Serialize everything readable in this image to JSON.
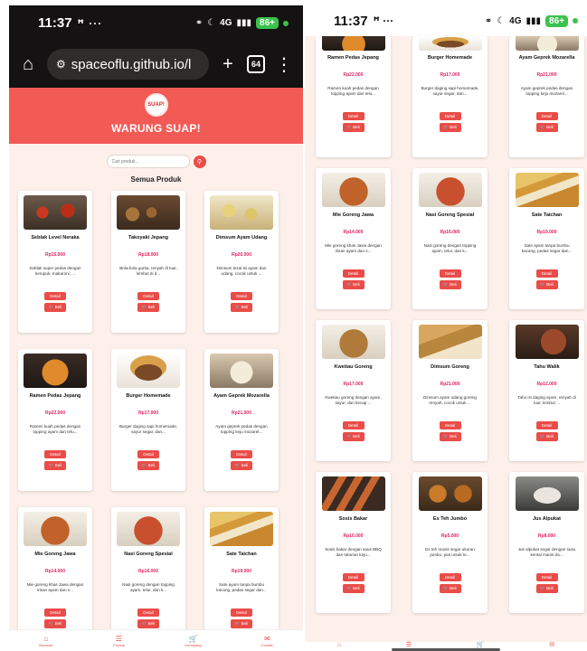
{
  "status": {
    "time": "11:37",
    "time_extra": "ꟸ ···",
    "battery": "86+",
    "signal": "4G"
  },
  "browser": {
    "url": "spaceoflu.github.io/l",
    "tabs": "64"
  },
  "header": {
    "logo_text": "SUAP!",
    "brand": "WARUNG SUAP!"
  },
  "search": {
    "placeholder": "Cari produk..."
  },
  "section_title": "Semua Produk",
  "buttons": {
    "detail": "Detail",
    "buy": "🛒 Beli"
  },
  "nav": [
    {
      "label": "Beranda",
      "icon": "home-icon"
    },
    {
      "label": "Produk",
      "icon": "list-icon"
    },
    {
      "label": "Keranjang",
      "icon": "cart-icon"
    },
    {
      "label": "Kontak",
      "icon": "mail-icon"
    }
  ],
  "products_left": [
    {
      "name": "Seblak Level Neraka",
      "price": "Rp15.000",
      "desc": "Seblak super pedas dengan kerupuk, makaroni, ..."
    },
    {
      "name": "Takoyaki Jepang",
      "price": "Rp18.000",
      "desc": "Bola-bola gurita, renyah di luar, lembut di d..."
    },
    {
      "name": "Dimsum Ayam Udang",
      "price": "Rp20.000",
      "desc": "Dimsum lezat isi ayam dan udang, cocok untuk ..."
    },
    {
      "name": "Ramen Pedas Jepang",
      "price": "Rp22.000",
      "desc": "Ramen kuah pedas dengan topping ayam dan telu..."
    },
    {
      "name": "Burger Homemade",
      "price": "Rp17.000",
      "desc": "Burger daging sapi homemade, sayur segar, dan..."
    },
    {
      "name": "Ayam Geprek Mozarella",
      "price": "Rp21.000",
      "desc": "Ayam geprek pedas dengan topping keju mozarel..."
    },
    {
      "name": "Mie Goreng Jawa",
      "price": "Rp14.000",
      "desc": "Mie goreng khas Jawa dengan irisan ayam dan s..."
    },
    {
      "name": "Nasi Goreng Spesial",
      "price": "Rp16.000",
      "desc": "Nasi goreng dengan topping ayam, telur, dan k..."
    },
    {
      "name": "Sate Taichan",
      "price": "Rp19.000",
      "desc": "Sate ayam tanpa bumbu kacang, pedas segar dan..."
    }
  ],
  "products_right": [
    {
      "name": "Ramen Pedas Jepang",
      "price": "Rp22.000",
      "desc": "Ramen kuah pedas dengan topping ayam dan telu..."
    },
    {
      "name": "Burger Homemade",
      "price": "Rp17.000",
      "desc": "Burger daging sapi homemade, sayur segar, dan..."
    },
    {
      "name": "Ayam Geprek Mozarella",
      "price": "Rp21.000",
      "desc": "Ayam geprek pedas dengan topping keju mozarel..."
    },
    {
      "name": "Mie Goreng Jawa",
      "price": "Rp14.000",
      "desc": "Mie goreng khas Jawa dengan irisan ayam dan s..."
    },
    {
      "name": "Nasi Goreng Spesial",
      "price": "Rp16.000",
      "desc": "Nasi goreng dengan topping ayam, telur, dan k..."
    },
    {
      "name": "Sate Taichan",
      "price": "Rp19.000",
      "desc": "Sate ayam tanpa bumbu kacang, pedas segar dan..."
    },
    {
      "name": "Kwetiau Goreng",
      "price": "Rp17.000",
      "desc": "Kwetiau goreng dengan ayam, sayur, dan kecap ..."
    },
    {
      "name": "Dimsum Goreng",
      "price": "Rp21.000",
      "desc": "Dimsum ayam udang goreng renyah, cocok untuk ..."
    },
    {
      "name": "Tahu Walik",
      "price": "Rp12.000",
      "desc": "Tahu isi daging ayam, renyah di luar, lembut ..."
    },
    {
      "name": "Sosis Bakar",
      "price": "Rp10.000",
      "desc": "Sosis bakar dengan saus BBQ dan taburan keju..."
    },
    {
      "name": "Es Teh Jumbo",
      "price": "Rp5.000",
      "desc": "Es teh manis segar ukuran jumbo, pas untuk te..."
    },
    {
      "name": "Jus Alpukat",
      "price": "Rp8.000",
      "desc": "Jus alpukat segar dengan susu kental manis da..."
    }
  ],
  "colors": {
    "accent": "#ea4c48",
    "hero": "#f25a56",
    "price": "#e0245e",
    "page_bg": "#fdf0ea"
  }
}
